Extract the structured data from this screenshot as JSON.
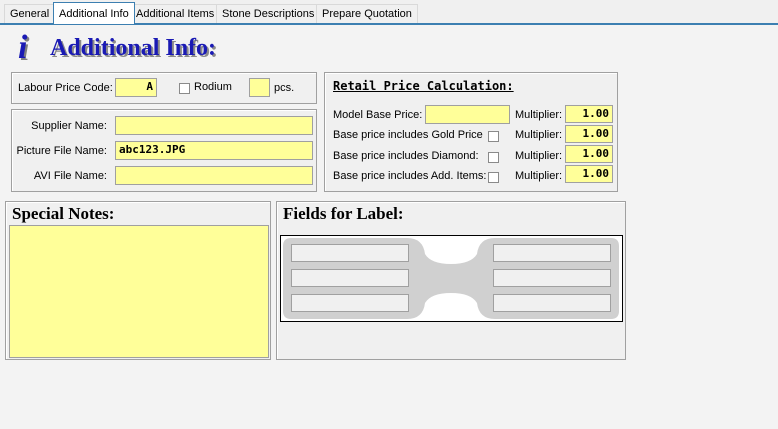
{
  "tabs": [
    "General",
    "Additional Info",
    "Additional Items",
    "Stone Descriptions",
    "Prepare Quotation"
  ],
  "active_tab": "Additional Info",
  "header": {
    "title": "Additional Info:",
    "icon": "info-icon"
  },
  "labour": {
    "price_code_label": "Labour Price Code:",
    "price_code_value": "A",
    "rodium_label": "Rodium",
    "pcs_value": "",
    "pcs_label": "pcs."
  },
  "supplier": {
    "supplier_label": "Supplier Name:",
    "supplier_value": "",
    "picture_label": "Picture File Name:",
    "picture_value": "abc123.JPG",
    "avi_label": "AVI File Name:",
    "avi_value": ""
  },
  "retail": {
    "title": "Retail Price Calculation:",
    "model_base_label": "Model Base Price:",
    "model_base_value": "",
    "gold_label": "Base price includes Gold Price",
    "diamond_label": "Base price includes Diamond:",
    "items_label": "Base price includes Add. Items:",
    "multiplier_label": "Multiplier:",
    "multipliers": [
      "1.00",
      "1.00",
      "1.00",
      "1.00"
    ]
  },
  "notes": {
    "title": "Special Notes:",
    "value": ""
  },
  "label_fields": {
    "title": "Fields for Label:"
  }
}
